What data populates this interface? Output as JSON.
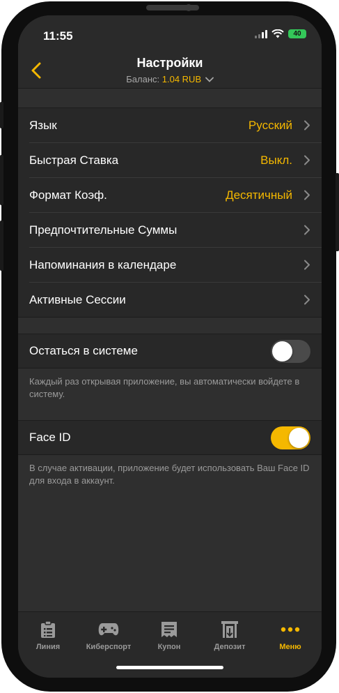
{
  "status": {
    "time": "11:55",
    "battery": "40"
  },
  "header": {
    "title": "Настройки",
    "balance_label": "Баланс:",
    "balance_amount": "1.04 RUB"
  },
  "settings": {
    "items": [
      {
        "label": "Язык",
        "value": "Русский"
      },
      {
        "label": "Быстрая Ставка",
        "value": "Выкл."
      },
      {
        "label": "Формат Коэф.",
        "value": "Десятичный"
      },
      {
        "label": "Предпочтительные Суммы",
        "value": ""
      },
      {
        "label": "Напоминания в календаре",
        "value": ""
      },
      {
        "label": "Активные Сессии",
        "value": ""
      }
    ]
  },
  "stay_logged_in": {
    "label": "Остаться в системе",
    "enabled": false,
    "hint": "Каждый раз открывая приложение, вы автоматически войдете в систему."
  },
  "face_id": {
    "label": "Face ID",
    "enabled": true,
    "hint": "В случае активации, приложение будет использовать Ваш Face ID для входа в аккаунт."
  },
  "tabbar": {
    "tabs": [
      {
        "label": "Линия",
        "icon": "clipboard-list-icon"
      },
      {
        "label": "Киберспорт",
        "icon": "gamepad-icon"
      },
      {
        "label": "Купон",
        "icon": "coupon-icon"
      },
      {
        "label": "Депозит",
        "icon": "deposit-icon"
      },
      {
        "label": "Меню",
        "icon": "more-dots-icon"
      }
    ],
    "active_index": 4
  },
  "colors": {
    "accent": "#f5b800",
    "background": "#2f2f2f",
    "row_bg": "#282828",
    "toggle_on": "#f5b800"
  }
}
